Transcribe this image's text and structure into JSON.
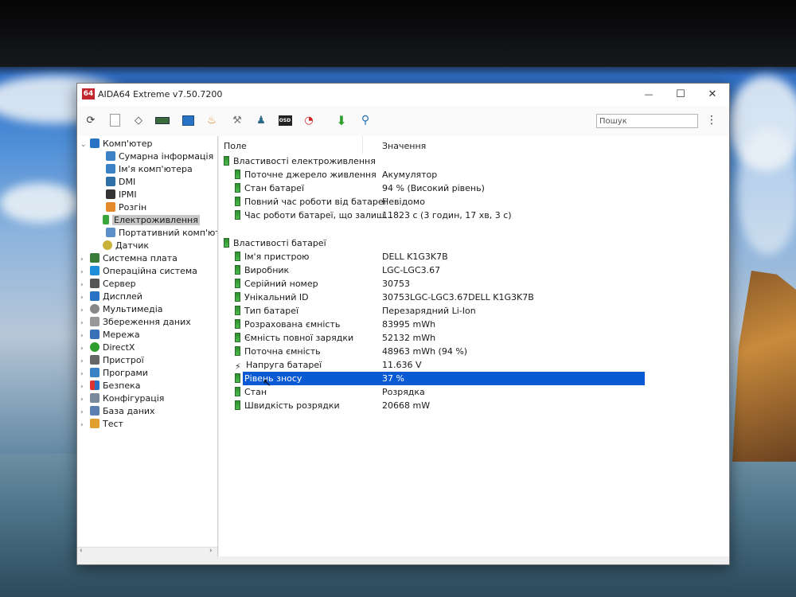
{
  "window": {
    "title": "AIDA64 Extreme v7.50.7200",
    "logo": "64",
    "controls": {
      "minimize": "—",
      "maximize": "☐",
      "close": "✕"
    }
  },
  "toolbar": {
    "search_placeholder": "Пошук",
    "icons": [
      "refresh-icon",
      "report-icon",
      "network-icon",
      "memory-icon",
      "computer-icon",
      "flame-icon",
      "tools-icon",
      "user-icon",
      "osd-icon",
      "gauge-icon",
      "download-icon",
      "search-icon"
    ]
  },
  "tree": {
    "root": "Комп'ютер",
    "children": [
      "Сумарна інформація",
      "Ім'я комп'ютера",
      "DMI",
      "IPMI",
      "Розгін",
      "Електроживлення",
      "Портативний комп'ютер",
      "Датчик"
    ],
    "selected": "Електроживлення",
    "groups": [
      "Системна плата",
      "Операційна система",
      "Сервер",
      "Дисплей",
      "Мультимедіа",
      "Збереження даних",
      "Мережа",
      "DirectX",
      "Пристрої",
      "Програми",
      "Безпека",
      "Конфігурація",
      "База даних",
      "Тест"
    ]
  },
  "columns": {
    "field": "Поле",
    "value": "Значення"
  },
  "sections": [
    {
      "title": "Властивості електроживлення",
      "rows": [
        {
          "field": "Поточне джерело живлення",
          "value": "Акумулятор"
        },
        {
          "field": "Стан батареї",
          "value": "94 % (Високий рівень)"
        },
        {
          "field": "Повний час роботи від батареї",
          "value": "Невідомо"
        },
        {
          "field": "Час роботи батареї, що залиш...",
          "value": "11823 с (3 годин, 17 хв, 3 с)"
        }
      ]
    },
    {
      "title": "Властивості батареї",
      "rows": [
        {
          "field": "Ім'я пристрою",
          "value": "DELL K1G3K7B"
        },
        {
          "field": "Виробник",
          "value": "LGC-LGC3.67"
        },
        {
          "field": "Серійний номер",
          "value": "30753"
        },
        {
          "field": "Унікальний ID",
          "value": "30753LGC-LGC3.67DELL K1G3K7B"
        },
        {
          "field": "Тип батареї",
          "value": "Перезарядний Li-Ion"
        },
        {
          "field": "Розрахована ємність",
          "value": "83995 mWh"
        },
        {
          "field": "Ємність повної зарядки",
          "value": "52132 mWh"
        },
        {
          "field": "Поточна ємність",
          "value": "48963 mWh  (94 %)"
        },
        {
          "field": "Напруга батареї",
          "value": "11.636 V"
        },
        {
          "field": "Рівень зносу",
          "value": "37 %"
        },
        {
          "field": "Стан",
          "value": "Розрядка"
        },
        {
          "field": "Швидкість розрядки",
          "value": "20668 mW"
        }
      ]
    }
  ],
  "selected_row": "Рівень зносу",
  "colors": {
    "selection": "#0a5bd3",
    "battery_green": "#3aa53a",
    "tree_selected": "#c8c8c8"
  }
}
